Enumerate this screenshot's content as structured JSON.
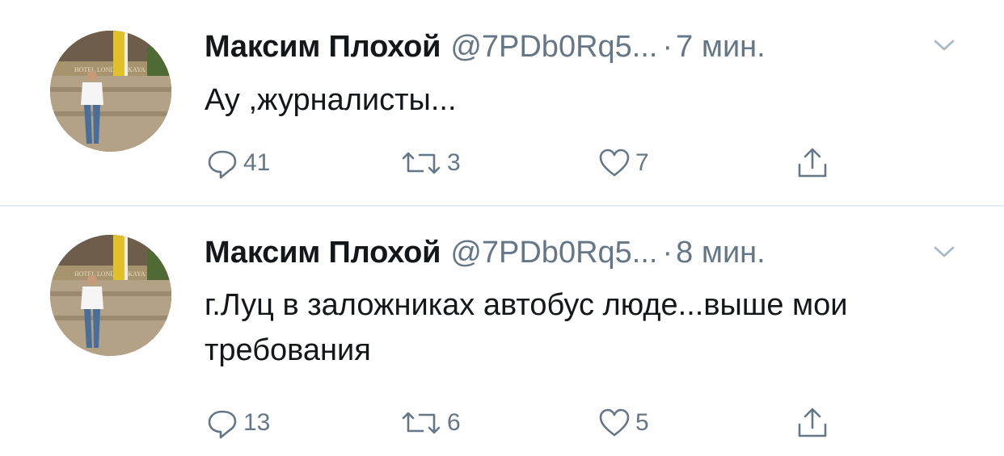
{
  "tweets": [
    {
      "name": "Максим Плохой",
      "handle": "@7PDb0Rq5...",
      "separator": "·",
      "time": "7 мин.",
      "text": "Ау ,журналисты...",
      "replies": "41",
      "retweets": "3",
      "likes": "7",
      "avatar_sign": "HOTEL  LONDONSKAYA"
    },
    {
      "name": "Максим Плохой",
      "handle": "@7PDb0Rq5...",
      "separator": "·",
      "time": "8 мин.",
      "text": "г.Луц в заложниках автобус люде...выше мои требования",
      "replies": "13",
      "retweets": "6",
      "likes": "5",
      "avatar_sign": "HOTEL  LONDONSKAYA"
    }
  ],
  "icons": {
    "reply": "reply-icon",
    "retweet": "retweet-icon",
    "like": "heart-icon",
    "share": "share-icon",
    "menu": "chevron-down-icon"
  },
  "colors": {
    "text": "#14171a",
    "secondary": "#657786",
    "divider": "#e6ecf0"
  }
}
